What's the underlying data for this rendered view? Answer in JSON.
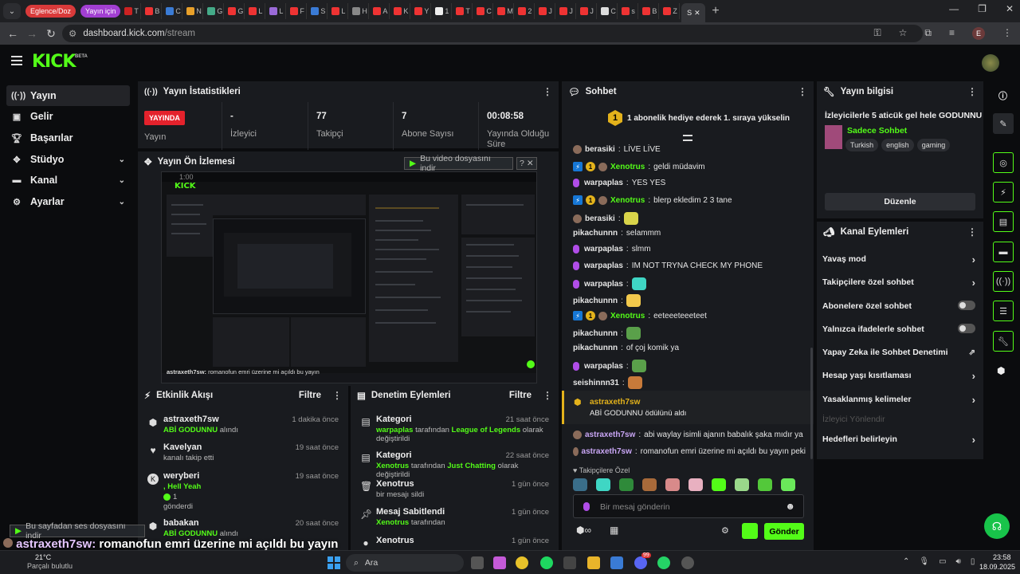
{
  "browser": {
    "tab_groups": [
      "Eglence/Doz",
      "Yayın için"
    ],
    "active_tab_label": "S",
    "url_host": "dashboard.kick.com",
    "url_path": "/stream",
    "profile_initial": "E"
  },
  "kick": {
    "logo": "KICK",
    "beta": "BETA"
  },
  "sidebar": {
    "items": [
      {
        "label": "Yayın",
        "icon": "broadcast-icon"
      },
      {
        "label": "Gelir",
        "icon": "money-icon"
      },
      {
        "label": "Başarılar",
        "icon": "trophy-icon"
      },
      {
        "label": "Stüdyo",
        "icon": "studio-icon"
      },
      {
        "label": "Kanal",
        "icon": "channel-icon"
      },
      {
        "label": "Ayarlar",
        "icon": "gear-icon"
      }
    ]
  },
  "stats": {
    "title": "Yayın İstatistikleri",
    "live_badge": "YAYINDA",
    "live_label": "Yayın",
    "viewers_value": "-",
    "viewers_label": "İzleyici",
    "followers_value": "77",
    "followers_label": "Takipçi",
    "subs_value": "7",
    "subs_label": "Abone Sayısı",
    "uptime_value": "00:08:58",
    "uptime_label": "Yayında Olduğu Süre"
  },
  "preview": {
    "title": "Yayın Ön İzlemesi",
    "video_overlay": "Bu video dosyasını indir",
    "audio_overlay": "Bu sayfadan ses dosyasını indir",
    "timecode": "1:00"
  },
  "activity": {
    "title": "Etkinlik Akışı",
    "filter": "Filtre",
    "items": [
      {
        "name": "astraxeth7sw",
        "highlight": "ABİ GODUNNU",
        "sub": "alındı",
        "time": "1 dakika önce"
      },
      {
        "name": "Kavelyan",
        "highlight": "",
        "sub": "kanalı takip etti",
        "time": "19 saat önce"
      },
      {
        "name": "weryberi",
        "highlight": ", Hell Yeah",
        "sub": "gönderdi",
        "count": "1",
        "time": "19 saat önce"
      },
      {
        "name": "babakan",
        "highlight": "ABİ GODUNNU",
        "sub": "alındı",
        "time": "20 saat önce"
      }
    ]
  },
  "moderation": {
    "title": "Denetim Eylemleri",
    "filter": "Filtre",
    "items": [
      {
        "title": "Kategori",
        "user": "warpaplas",
        "mid": "tarafından",
        "target": "League of Legends",
        "tail": "olarak değiştirildi",
        "time": "21 saat önce"
      },
      {
        "title": "Kategori",
        "user": "Xenotrus",
        "mid": "tarafından",
        "target": "Just Chatting",
        "tail": "olarak değiştirildi",
        "time": "22 saat önce"
      },
      {
        "title": "Xenotrus",
        "user": "",
        "mid": "bir mesajı sildi",
        "target": "",
        "tail": "",
        "time": "1 gün önce"
      },
      {
        "title": "Mesaj Sabitlendi",
        "user": "Xenotrus",
        "mid": "tarafından",
        "target": "",
        "tail": "",
        "time": "1 gün önce"
      },
      {
        "title": "Xenotrus",
        "user": "",
        "mid": "",
        "target": "",
        "tail": "",
        "time": "1 gün önce"
      }
    ]
  },
  "chat": {
    "title": "Sohbet",
    "pinned_badge": "1",
    "pinned_text": "1 abonelik hediye ederek 1. sıraya yükselin",
    "messages": [
      {
        "user": "berasiki",
        "text": "LİVE LİVE",
        "color": "#e5e5e5",
        "badges": [
          "av"
        ]
      },
      {
        "user": "Xenotrus",
        "text": "geldi müdavim",
        "color": "#53fc18",
        "badges": [
          "bolt",
          "one",
          "av"
        ]
      },
      {
        "user": "warpaplas",
        "text": "YES YES",
        "color": "#e5e5e5",
        "badges": [
          "mic"
        ]
      },
      {
        "user": "Xenotrus",
        "text": "blerp ekledim 2 3 tane",
        "color": "#53fc18",
        "badges": [
          "bolt",
          "one",
          "av"
        ]
      },
      {
        "user": "berasiki",
        "text": "",
        "color": "#e5e5e5",
        "badges": [
          "av"
        ],
        "emote": "#d9d44a"
      },
      {
        "user": "pikachunnn",
        "text": "selammm",
        "color": "#e5e5e5",
        "badges": []
      },
      {
        "user": "warpaplas",
        "text": "slmm",
        "color": "#e5e5e5",
        "badges": [
          "mic"
        ]
      },
      {
        "user": "warpaplas",
        "text": "IM NOT TRYNA CHECK MY PHONE",
        "color": "#e5e5e5",
        "badges": [
          "mic"
        ]
      },
      {
        "user": "warpaplas",
        "text": "",
        "color": "#e5e5e5",
        "badges": [
          "mic"
        ],
        "emote": "#3fd6c4"
      },
      {
        "user": "pikachunnn",
        "text": "",
        "color": "#e5e5e5",
        "badges": [],
        "emote": "#f2c94c"
      },
      {
        "user": "Xenotrus",
        "text": "eeteeeteeeteet",
        "color": "#53fc18",
        "badges": [
          "bolt",
          "one",
          "av"
        ]
      },
      {
        "user": "pikachunnn",
        "text": "",
        "color": "#e5e5e5",
        "badges": [],
        "emote": "#5aa04a"
      },
      {
        "user": "pikachunnn",
        "text": "of çoj komik ya",
        "color": "#e5e5e5",
        "badges": []
      },
      {
        "user": "warpaplas",
        "text": "",
        "color": "#e5e5e5",
        "badges": [
          "mic"
        ],
        "emote": "#5aa04a"
      },
      {
        "user": "seishinnn31",
        "text": "",
        "color": "#e5e5e5",
        "badges": [],
        "emote": "#c87a3a"
      }
    ],
    "reward_user": "astraxeth7sw",
    "reward_text": "ABİ GODUNNU ödülünü aldı",
    "late_messages": [
      {
        "user": "astraxeth7sw",
        "text": "abi waylay isimli ajanın babalık şaka mıdır ya"
      },
      {
        "user": "astraxeth7sw",
        "text": "romanofun emri üzerine mi açıldı bu yayın peki"
      }
    ],
    "followers_only": "Takipçilere Özel",
    "input_placeholder": "Bir mesaj gönderin",
    "send": "Gönder"
  },
  "info": {
    "title": "Yayın bilgisi",
    "stream_title": "İzleyicilerle 5 aticük gel hele GODUNNU",
    "category": "Sadece Sohbet",
    "tags": [
      "Turkish",
      "english",
      "gaming"
    ],
    "edit": "Düzenle"
  },
  "channel_actions": {
    "title": "Kanal Eylemleri",
    "items": [
      {
        "label": "Yavaş mod",
        "kind": "arrow"
      },
      {
        "label": "Takipçilere özel sohbet",
        "kind": "arrow"
      },
      {
        "label": "Abonelere özel sohbet",
        "kind": "toggle"
      },
      {
        "label": "Yalnızca ifadelerle sohbet",
        "kind": "toggle"
      },
      {
        "label": "Yapay Zeka ile Sohbet Denetimi",
        "kind": "external"
      },
      {
        "label": "Hesap yaşı kısıtlaması",
        "kind": "arrow"
      },
      {
        "label": "Yasaklanmış kelimeler",
        "kind": "arrow"
      },
      {
        "label": "İzleyici Yönlendir",
        "kind": "disabled"
      },
      {
        "label": "Hedefleri belirleyin",
        "kind": "arrow"
      }
    ]
  },
  "subtitle_overlay": {
    "user": "astraxeth7sw:",
    "text": "romanofun emri üzerine mi açıldı bu yayın",
    "tail": "peki"
  },
  "taskbar": {
    "weather_temp": "21°C",
    "weather_text": "Parçalı bulutlu",
    "search": "Ara",
    "time": "23:58",
    "date": "18.09.2025",
    "badge_count": "99"
  },
  "colors": {
    "accent": "#53fc18",
    "live": "#e4222c",
    "panel": "#191b1f"
  }
}
